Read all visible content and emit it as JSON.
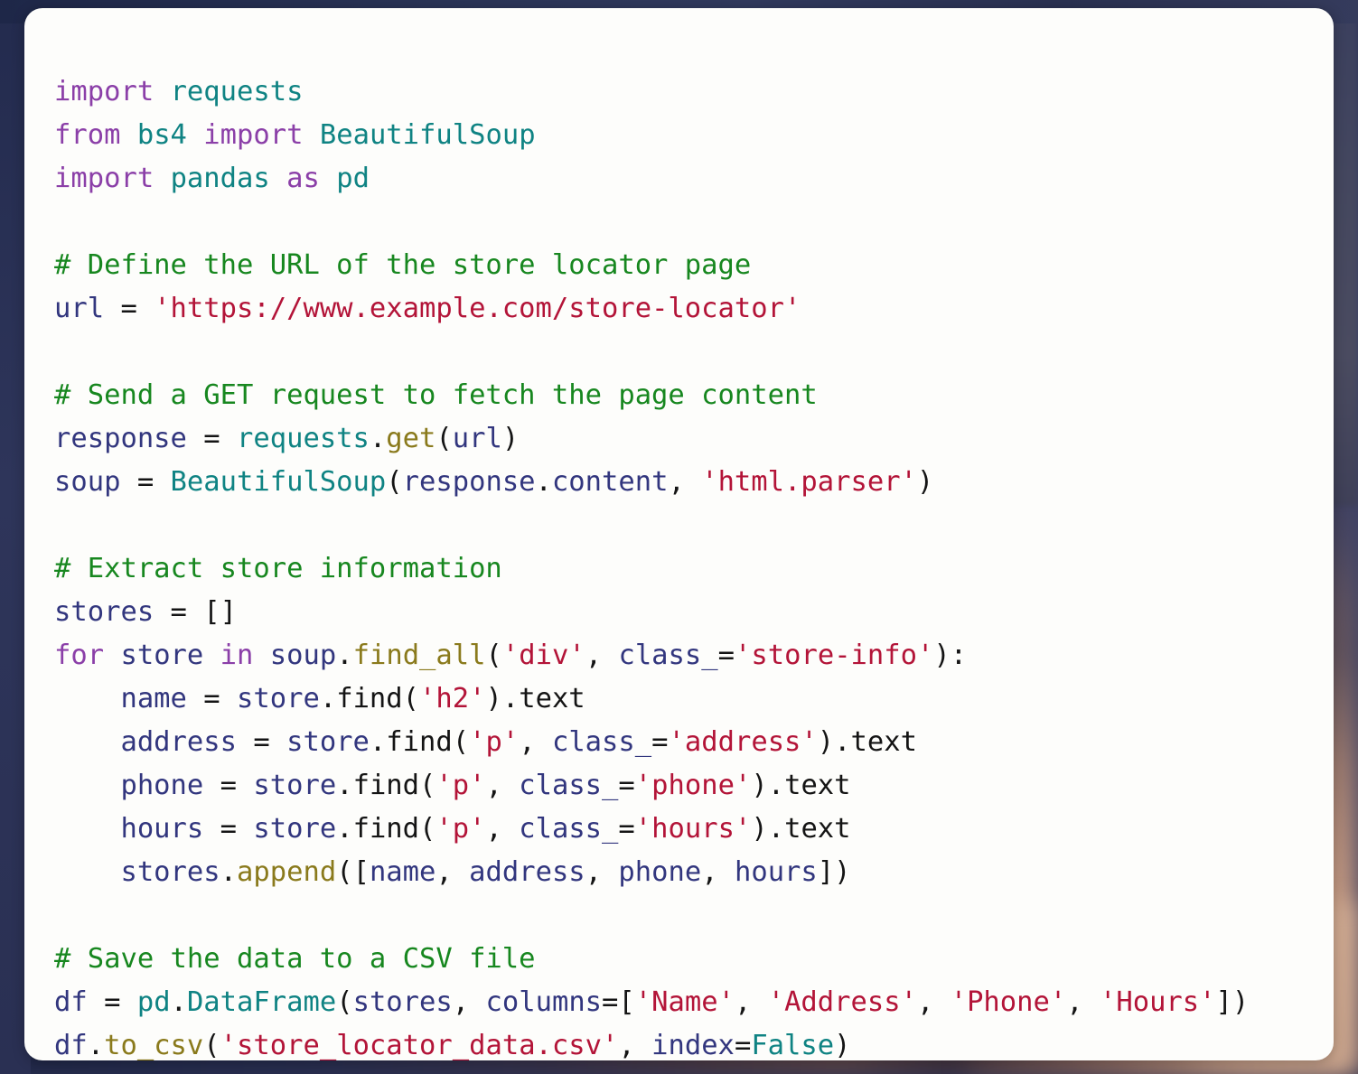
{
  "card": {
    "background_color": "#fdfdfb",
    "corner_radius_px": 20,
    "language": "python"
  },
  "backdrop": {
    "type": "blurred-photo",
    "dominant_color": "#2b3254",
    "accent_color": "#c69a7c"
  },
  "palette": {
    "keyword": "#8b3fa8",
    "module": "#0f8383",
    "comment": "#17871f",
    "string": "#b31438",
    "identifier": "#32367e",
    "function": "#8a7a1c",
    "punctuation": "#141414"
  },
  "code": {
    "lines": [
      {
        "n": 1,
        "tokens": [
          {
            "t": "import",
            "c": "kw"
          },
          {
            "t": " ",
            "c": "pun"
          },
          {
            "t": "requests",
            "c": "mod"
          }
        ]
      },
      {
        "n": 2,
        "tokens": [
          {
            "t": "from",
            "c": "kw"
          },
          {
            "t": " ",
            "c": "pun"
          },
          {
            "t": "bs4",
            "c": "mod"
          },
          {
            "t": " ",
            "c": "pun"
          },
          {
            "t": "import",
            "c": "kw"
          },
          {
            "t": " ",
            "c": "pun"
          },
          {
            "t": "BeautifulSoup",
            "c": "mod"
          }
        ]
      },
      {
        "n": 3,
        "tokens": [
          {
            "t": "import",
            "c": "kw"
          },
          {
            "t": " ",
            "c": "pun"
          },
          {
            "t": "pandas",
            "c": "mod"
          },
          {
            "t": " ",
            "c": "pun"
          },
          {
            "t": "as",
            "c": "kw"
          },
          {
            "t": " ",
            "c": "pun"
          },
          {
            "t": "pd",
            "c": "mod"
          }
        ]
      },
      {
        "n": 4,
        "tokens": []
      },
      {
        "n": 5,
        "tokens": [
          {
            "t": "# Define the URL of the store locator page",
            "c": "cmt"
          }
        ]
      },
      {
        "n": 6,
        "tokens": [
          {
            "t": "url",
            "c": "var"
          },
          {
            "t": " = ",
            "c": "op"
          },
          {
            "t": "'https://www.example.com/store-locator'",
            "c": "str"
          }
        ]
      },
      {
        "n": 7,
        "tokens": []
      },
      {
        "n": 8,
        "tokens": [
          {
            "t": "# Send a GET request to fetch the page content",
            "c": "cmt"
          }
        ]
      },
      {
        "n": 9,
        "tokens": [
          {
            "t": "response",
            "c": "var"
          },
          {
            "t": " = ",
            "c": "op"
          },
          {
            "t": "requests",
            "c": "mod"
          },
          {
            "t": ".",
            "c": "pun"
          },
          {
            "t": "get",
            "c": "fn"
          },
          {
            "t": "(",
            "c": "pun"
          },
          {
            "t": "url",
            "c": "var"
          },
          {
            "t": ")",
            "c": "pun"
          }
        ]
      },
      {
        "n": 10,
        "tokens": [
          {
            "t": "soup",
            "c": "var"
          },
          {
            "t": " = ",
            "c": "op"
          },
          {
            "t": "BeautifulSoup",
            "c": "mod"
          },
          {
            "t": "(",
            "c": "pun"
          },
          {
            "t": "response",
            "c": "var"
          },
          {
            "t": ".",
            "c": "pun"
          },
          {
            "t": "content",
            "c": "var"
          },
          {
            "t": ", ",
            "c": "pun"
          },
          {
            "t": "'html.parser'",
            "c": "str"
          },
          {
            "t": ")",
            "c": "pun"
          }
        ]
      },
      {
        "n": 11,
        "tokens": []
      },
      {
        "n": 12,
        "tokens": [
          {
            "t": "# Extract store information",
            "c": "cmt"
          }
        ]
      },
      {
        "n": 13,
        "tokens": [
          {
            "t": "stores",
            "c": "var"
          },
          {
            "t": " = ",
            "c": "op"
          },
          {
            "t": "[]",
            "c": "pun"
          }
        ]
      },
      {
        "n": 14,
        "tokens": [
          {
            "t": "for",
            "c": "kw"
          },
          {
            "t": " ",
            "c": "pun"
          },
          {
            "t": "store",
            "c": "var"
          },
          {
            "t": " ",
            "c": "pun"
          },
          {
            "t": "in",
            "c": "kw"
          },
          {
            "t": " ",
            "c": "pun"
          },
          {
            "t": "soup",
            "c": "var"
          },
          {
            "t": ".",
            "c": "pun"
          },
          {
            "t": "find_all",
            "c": "fn"
          },
          {
            "t": "(",
            "c": "pun"
          },
          {
            "t": "'div'",
            "c": "str"
          },
          {
            "t": ", ",
            "c": "pun"
          },
          {
            "t": "class_",
            "c": "var"
          },
          {
            "t": "=",
            "c": "op"
          },
          {
            "t": "'store-info'",
            "c": "str"
          },
          {
            "t": "):",
            "c": "pun"
          }
        ]
      },
      {
        "n": 15,
        "tokens": [
          {
            "t": "    ",
            "c": "pun"
          },
          {
            "t": "name",
            "c": "var"
          },
          {
            "t": " = ",
            "c": "op"
          },
          {
            "t": "store",
            "c": "var"
          },
          {
            "t": ".",
            "c": "pun"
          },
          {
            "t": "find",
            "c": "pun"
          },
          {
            "t": "(",
            "c": "pun"
          },
          {
            "t": "'h2'",
            "c": "str"
          },
          {
            "t": ")",
            "c": "pun"
          },
          {
            "t": ".text",
            "c": "pun"
          }
        ]
      },
      {
        "n": 16,
        "tokens": [
          {
            "t": "    ",
            "c": "pun"
          },
          {
            "t": "address",
            "c": "var"
          },
          {
            "t": " = ",
            "c": "op"
          },
          {
            "t": "store",
            "c": "var"
          },
          {
            "t": ".",
            "c": "pun"
          },
          {
            "t": "find",
            "c": "pun"
          },
          {
            "t": "(",
            "c": "pun"
          },
          {
            "t": "'p'",
            "c": "str"
          },
          {
            "t": ", ",
            "c": "pun"
          },
          {
            "t": "class_",
            "c": "var"
          },
          {
            "t": "=",
            "c": "op"
          },
          {
            "t": "'address'",
            "c": "str"
          },
          {
            "t": ")",
            "c": "pun"
          },
          {
            "t": ".text",
            "c": "pun"
          }
        ]
      },
      {
        "n": 17,
        "tokens": [
          {
            "t": "    ",
            "c": "pun"
          },
          {
            "t": "phone",
            "c": "var"
          },
          {
            "t": " = ",
            "c": "op"
          },
          {
            "t": "store",
            "c": "var"
          },
          {
            "t": ".",
            "c": "pun"
          },
          {
            "t": "find",
            "c": "pun"
          },
          {
            "t": "(",
            "c": "pun"
          },
          {
            "t": "'p'",
            "c": "str"
          },
          {
            "t": ", ",
            "c": "pun"
          },
          {
            "t": "class_",
            "c": "var"
          },
          {
            "t": "=",
            "c": "op"
          },
          {
            "t": "'phone'",
            "c": "str"
          },
          {
            "t": ")",
            "c": "pun"
          },
          {
            "t": ".text",
            "c": "pun"
          }
        ]
      },
      {
        "n": 18,
        "tokens": [
          {
            "t": "    ",
            "c": "pun"
          },
          {
            "t": "hours",
            "c": "var"
          },
          {
            "t": " = ",
            "c": "op"
          },
          {
            "t": "store",
            "c": "var"
          },
          {
            "t": ".",
            "c": "pun"
          },
          {
            "t": "find",
            "c": "pun"
          },
          {
            "t": "(",
            "c": "pun"
          },
          {
            "t": "'p'",
            "c": "str"
          },
          {
            "t": ", ",
            "c": "pun"
          },
          {
            "t": "class_",
            "c": "var"
          },
          {
            "t": "=",
            "c": "op"
          },
          {
            "t": "'hours'",
            "c": "str"
          },
          {
            "t": ")",
            "c": "pun"
          },
          {
            "t": ".text",
            "c": "pun"
          }
        ]
      },
      {
        "n": 19,
        "tokens": [
          {
            "t": "    ",
            "c": "pun"
          },
          {
            "t": "stores",
            "c": "var"
          },
          {
            "t": ".",
            "c": "pun"
          },
          {
            "t": "append",
            "c": "fn"
          },
          {
            "t": "([",
            "c": "pun"
          },
          {
            "t": "name",
            "c": "var"
          },
          {
            "t": ", ",
            "c": "pun"
          },
          {
            "t": "address",
            "c": "var"
          },
          {
            "t": ", ",
            "c": "pun"
          },
          {
            "t": "phone",
            "c": "var"
          },
          {
            "t": ", ",
            "c": "pun"
          },
          {
            "t": "hours",
            "c": "var"
          },
          {
            "t": "])",
            "c": "pun"
          }
        ]
      },
      {
        "n": 20,
        "tokens": []
      },
      {
        "n": 21,
        "tokens": [
          {
            "t": "# Save the data to a CSV file",
            "c": "cmt"
          }
        ]
      },
      {
        "n": 22,
        "tokens": [
          {
            "t": "df",
            "c": "var"
          },
          {
            "t": " = ",
            "c": "op"
          },
          {
            "t": "pd",
            "c": "mod"
          },
          {
            "t": ".",
            "c": "pun"
          },
          {
            "t": "DataFrame",
            "c": "mod"
          },
          {
            "t": "(",
            "c": "pun"
          },
          {
            "t": "stores",
            "c": "var"
          },
          {
            "t": ", ",
            "c": "pun"
          },
          {
            "t": "columns",
            "c": "var"
          },
          {
            "t": "=[",
            "c": "pun"
          },
          {
            "t": "'Name'",
            "c": "str"
          },
          {
            "t": ", ",
            "c": "pun"
          },
          {
            "t": "'Address'",
            "c": "str"
          },
          {
            "t": ", ",
            "c": "pun"
          },
          {
            "t": "'Phone'",
            "c": "str"
          },
          {
            "t": ", ",
            "c": "pun"
          },
          {
            "t": "'Hours'",
            "c": "str"
          },
          {
            "t": "])",
            "c": "pun"
          }
        ]
      },
      {
        "n": 23,
        "tokens": [
          {
            "t": "df",
            "c": "var"
          },
          {
            "t": ".",
            "c": "pun"
          },
          {
            "t": "to_csv",
            "c": "fn"
          },
          {
            "t": "(",
            "c": "pun"
          },
          {
            "t": "'store_locator_data.csv'",
            "c": "str"
          },
          {
            "t": ", ",
            "c": "pun"
          },
          {
            "t": "index",
            "c": "var"
          },
          {
            "t": "=",
            "c": "op"
          },
          {
            "t": "False",
            "c": "mod"
          },
          {
            "t": ")",
            "c": "pun"
          }
        ]
      }
    ],
    "plain_text": "import requests\nfrom bs4 import BeautifulSoup\nimport pandas as pd\n\n# Define the URL of the store locator page\nurl = 'https://www.example.com/store-locator'\n\n# Send a GET request to fetch the page content\nresponse = requests.get(url)\nsoup = BeautifulSoup(response.content, 'html.parser')\n\n# Extract store information\nstores = []\nfor store in soup.find_all('div', class_='store-info'):\n    name = store.find('h2').text\n    address = store.find('p', class_='address').text\n    phone = store.find('p', class_='phone').text\n    hours = store.find('p', class_='hours').text\n    stores.append([name, address, phone, hours])\n\n# Save the data to a CSV file\ndf = pd.DataFrame(stores, columns=['Name', 'Address', 'Phone', 'Hours'])\ndf.to_csv('store_locator_data.csv', index=False)"
  }
}
